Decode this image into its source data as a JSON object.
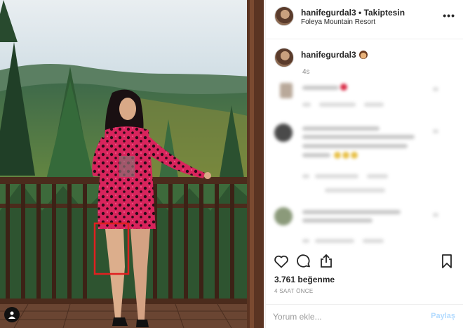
{
  "header": {
    "username": "hanifegurdal3",
    "separator": " • ",
    "follow_label": "Takiptesin",
    "location": "Foleya Mountain Resort",
    "more_icon": "ellipsis-icon"
  },
  "caption": {
    "username": "hanifegurdal3",
    "emoji_icon": "monkey-emoji-icon",
    "time": "4s"
  },
  "actions": {
    "like_icon": "heart-icon",
    "comment_icon": "comment-bubble-icon",
    "share_icon": "share-icon",
    "save_icon": "bookmark-icon"
  },
  "likes": "3.761 beğenme",
  "post_time": "4 SAAT ÖNCE",
  "comment_bar": {
    "placeholder": "Yorum ekle...",
    "post_label": "Paylaş"
  },
  "colors": {
    "highlight_box": "#e02020",
    "post_button_disabled": "#b3dbff",
    "dress": "#d8245c"
  }
}
